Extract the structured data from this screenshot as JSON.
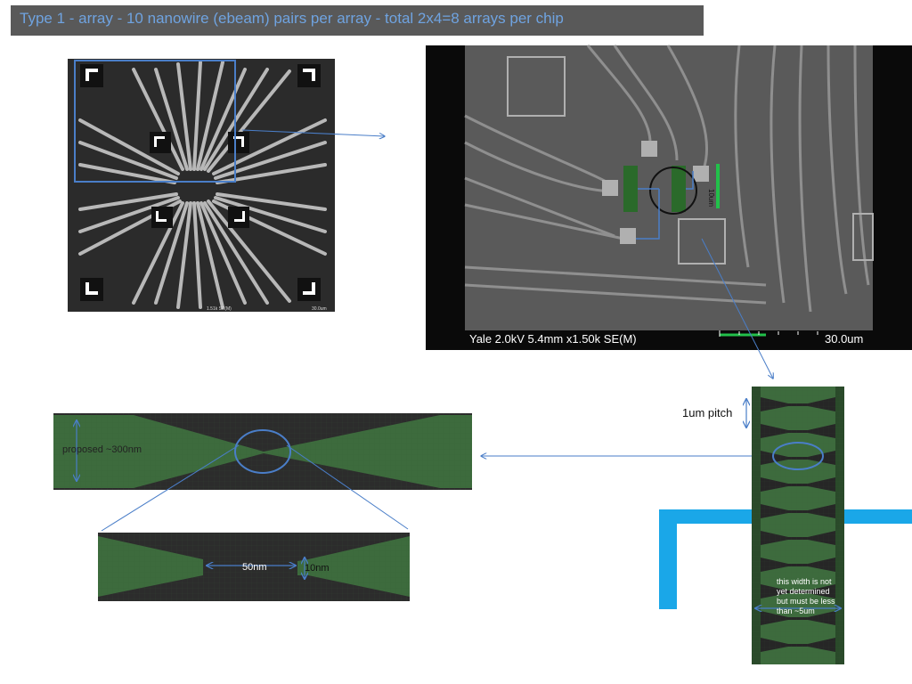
{
  "title": "Type 1 - array - 10 nanowire (ebeam)  pairs per array  -  total 2x4=8 arrays per chip",
  "sem_left": {
    "mag_label": "1.51k SE(M)",
    "scale_label": "30.0um"
  },
  "sem_right": {
    "caption": "Yale 2.0kV 5.4mm x1.50k SE(M)",
    "scale_label": "30.0um",
    "inset_scale_label": "10um"
  },
  "labels": {
    "proposed": "proposed  ~300nm",
    "gap": "50nm",
    "width": "10nm",
    "pitch": "1um pitch",
    "strip_note": "this width is not yet determined but must be less than ~5um"
  },
  "colors": {
    "title_bg": "#595959",
    "title_text": "#6fa3e0",
    "nanowire_green": "#3d6b3d",
    "contact_blue": "#1aa7e8",
    "arrow_blue": "#4a7ec8",
    "scale_green": "#22c04a"
  }
}
